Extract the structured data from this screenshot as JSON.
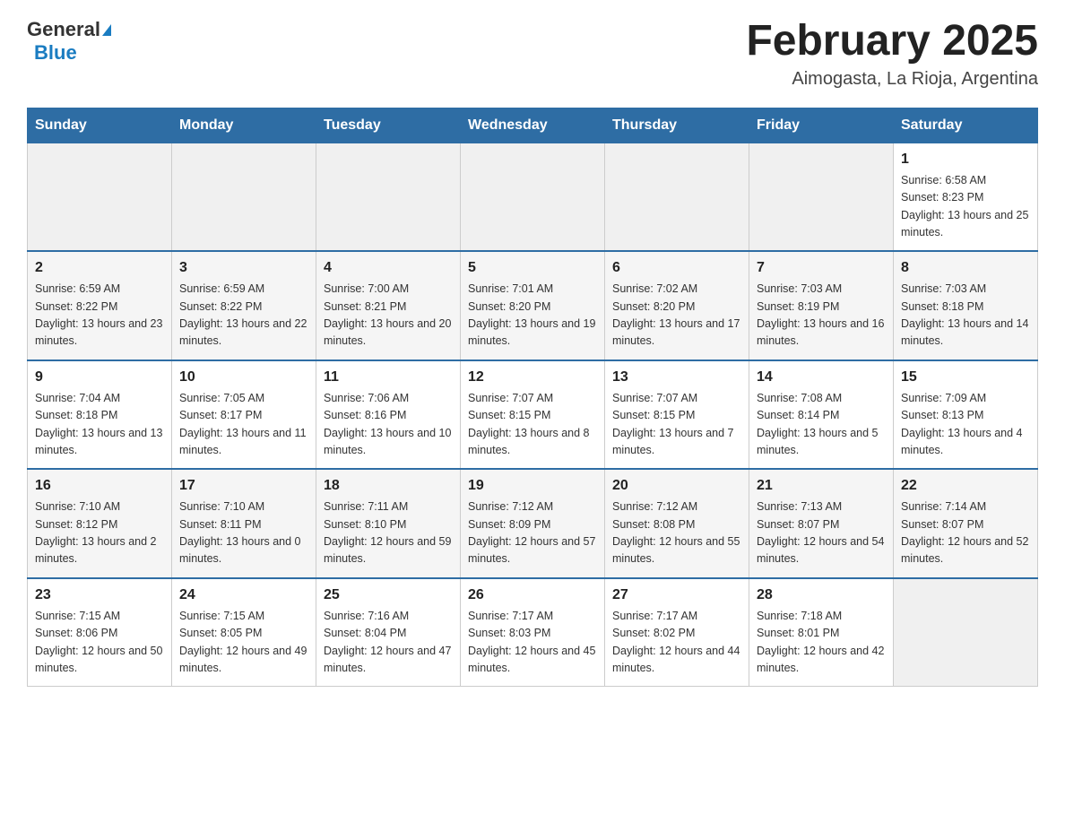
{
  "header": {
    "logo": {
      "line1": "General",
      "line2": "Blue"
    },
    "title": "February 2025",
    "subtitle": "Aimogasta, La Rioja, Argentina"
  },
  "calendar": {
    "days_of_week": [
      "Sunday",
      "Monday",
      "Tuesday",
      "Wednesday",
      "Thursday",
      "Friday",
      "Saturday"
    ],
    "weeks": [
      {
        "days": [
          {
            "date": "",
            "info": ""
          },
          {
            "date": "",
            "info": ""
          },
          {
            "date": "",
            "info": ""
          },
          {
            "date": "",
            "info": ""
          },
          {
            "date": "",
            "info": ""
          },
          {
            "date": "",
            "info": ""
          },
          {
            "date": "1",
            "info": "Sunrise: 6:58 AM\nSunset: 8:23 PM\nDaylight: 13 hours and 25 minutes."
          }
        ]
      },
      {
        "days": [
          {
            "date": "2",
            "info": "Sunrise: 6:59 AM\nSunset: 8:22 PM\nDaylight: 13 hours and 23 minutes."
          },
          {
            "date": "3",
            "info": "Sunrise: 6:59 AM\nSunset: 8:22 PM\nDaylight: 13 hours and 22 minutes."
          },
          {
            "date": "4",
            "info": "Sunrise: 7:00 AM\nSunset: 8:21 PM\nDaylight: 13 hours and 20 minutes."
          },
          {
            "date": "5",
            "info": "Sunrise: 7:01 AM\nSunset: 8:20 PM\nDaylight: 13 hours and 19 minutes."
          },
          {
            "date": "6",
            "info": "Sunrise: 7:02 AM\nSunset: 8:20 PM\nDaylight: 13 hours and 17 minutes."
          },
          {
            "date": "7",
            "info": "Sunrise: 7:03 AM\nSunset: 8:19 PM\nDaylight: 13 hours and 16 minutes."
          },
          {
            "date": "8",
            "info": "Sunrise: 7:03 AM\nSunset: 8:18 PM\nDaylight: 13 hours and 14 minutes."
          }
        ]
      },
      {
        "days": [
          {
            "date": "9",
            "info": "Sunrise: 7:04 AM\nSunset: 8:18 PM\nDaylight: 13 hours and 13 minutes."
          },
          {
            "date": "10",
            "info": "Sunrise: 7:05 AM\nSunset: 8:17 PM\nDaylight: 13 hours and 11 minutes."
          },
          {
            "date": "11",
            "info": "Sunrise: 7:06 AM\nSunset: 8:16 PM\nDaylight: 13 hours and 10 minutes."
          },
          {
            "date": "12",
            "info": "Sunrise: 7:07 AM\nSunset: 8:15 PM\nDaylight: 13 hours and 8 minutes."
          },
          {
            "date": "13",
            "info": "Sunrise: 7:07 AM\nSunset: 8:15 PM\nDaylight: 13 hours and 7 minutes."
          },
          {
            "date": "14",
            "info": "Sunrise: 7:08 AM\nSunset: 8:14 PM\nDaylight: 13 hours and 5 minutes."
          },
          {
            "date": "15",
            "info": "Sunrise: 7:09 AM\nSunset: 8:13 PM\nDaylight: 13 hours and 4 minutes."
          }
        ]
      },
      {
        "days": [
          {
            "date": "16",
            "info": "Sunrise: 7:10 AM\nSunset: 8:12 PM\nDaylight: 13 hours and 2 minutes."
          },
          {
            "date": "17",
            "info": "Sunrise: 7:10 AM\nSunset: 8:11 PM\nDaylight: 13 hours and 0 minutes."
          },
          {
            "date": "18",
            "info": "Sunrise: 7:11 AM\nSunset: 8:10 PM\nDaylight: 12 hours and 59 minutes."
          },
          {
            "date": "19",
            "info": "Sunrise: 7:12 AM\nSunset: 8:09 PM\nDaylight: 12 hours and 57 minutes."
          },
          {
            "date": "20",
            "info": "Sunrise: 7:12 AM\nSunset: 8:08 PM\nDaylight: 12 hours and 55 minutes."
          },
          {
            "date": "21",
            "info": "Sunrise: 7:13 AM\nSunset: 8:07 PM\nDaylight: 12 hours and 54 minutes."
          },
          {
            "date": "22",
            "info": "Sunrise: 7:14 AM\nSunset: 8:07 PM\nDaylight: 12 hours and 52 minutes."
          }
        ]
      },
      {
        "days": [
          {
            "date": "23",
            "info": "Sunrise: 7:15 AM\nSunset: 8:06 PM\nDaylight: 12 hours and 50 minutes."
          },
          {
            "date": "24",
            "info": "Sunrise: 7:15 AM\nSunset: 8:05 PM\nDaylight: 12 hours and 49 minutes."
          },
          {
            "date": "25",
            "info": "Sunrise: 7:16 AM\nSunset: 8:04 PM\nDaylight: 12 hours and 47 minutes."
          },
          {
            "date": "26",
            "info": "Sunrise: 7:17 AM\nSunset: 8:03 PM\nDaylight: 12 hours and 45 minutes."
          },
          {
            "date": "27",
            "info": "Sunrise: 7:17 AM\nSunset: 8:02 PM\nDaylight: 12 hours and 44 minutes."
          },
          {
            "date": "28",
            "info": "Sunrise: 7:18 AM\nSunset: 8:01 PM\nDaylight: 12 hours and 42 minutes."
          },
          {
            "date": "",
            "info": ""
          }
        ]
      }
    ]
  }
}
